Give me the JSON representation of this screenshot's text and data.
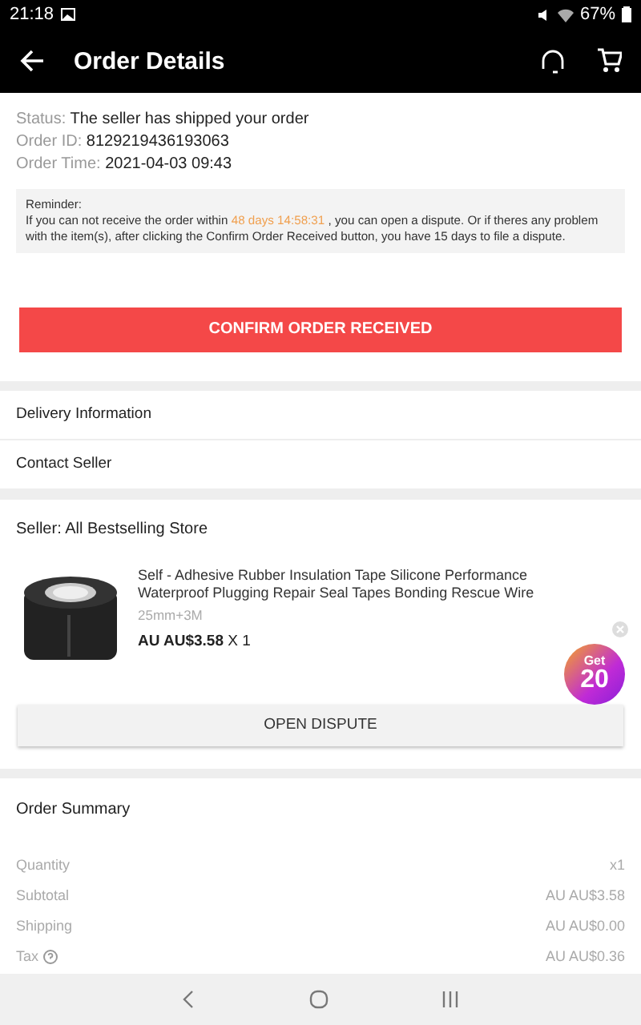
{
  "status_bar": {
    "time": "21:18",
    "battery": "67%"
  },
  "app_bar": {
    "title": "Order Details"
  },
  "order_info": [
    {
      "label": "Status:",
      "value": "The seller has shipped your order"
    },
    {
      "label": "Order ID:",
      "value": "8129219436193063"
    },
    {
      "label": "Order Time:",
      "value": "2021-04-03 09:43"
    }
  ],
  "reminder": {
    "title": "Reminder:",
    "before": "If you can not receive the order within",
    "countdown": "48 days 14:58:31",
    "after": ", you can open a dispute. Or if theres any problem with the item(s), after clicking the Confirm Order Received button, you have 15 days to file a dispute."
  },
  "confirm_button": "CONFIRM ORDER RECEIVED",
  "links": [
    "Delivery Information",
    "Contact Seller"
  ],
  "seller": "Seller: All Bestselling Store",
  "product": {
    "title": "Self - Adhesive Rubber Insulation Tape Silicone Performance Waterproof Plugging Repair Seal Tapes Bonding Rescue Wire",
    "variant": "25mm+3M",
    "price": "AU AU$3.58",
    "quantity": "X 1"
  },
  "promo_badge": {
    "label": "Get",
    "value": "20"
  },
  "dispute_button": "OPEN DISPUTE",
  "summary": {
    "title": "Order Summary",
    "rows": [
      {
        "label": "Quantity",
        "value": "x1",
        "help": false
      },
      {
        "label": "Subtotal",
        "value": "AU AU$3.58",
        "help": false
      },
      {
        "label": "Shipping",
        "value": "AU AU$0.00",
        "help": false
      },
      {
        "label": "Tax",
        "value": "AU AU$0.36",
        "help": true
      }
    ]
  }
}
